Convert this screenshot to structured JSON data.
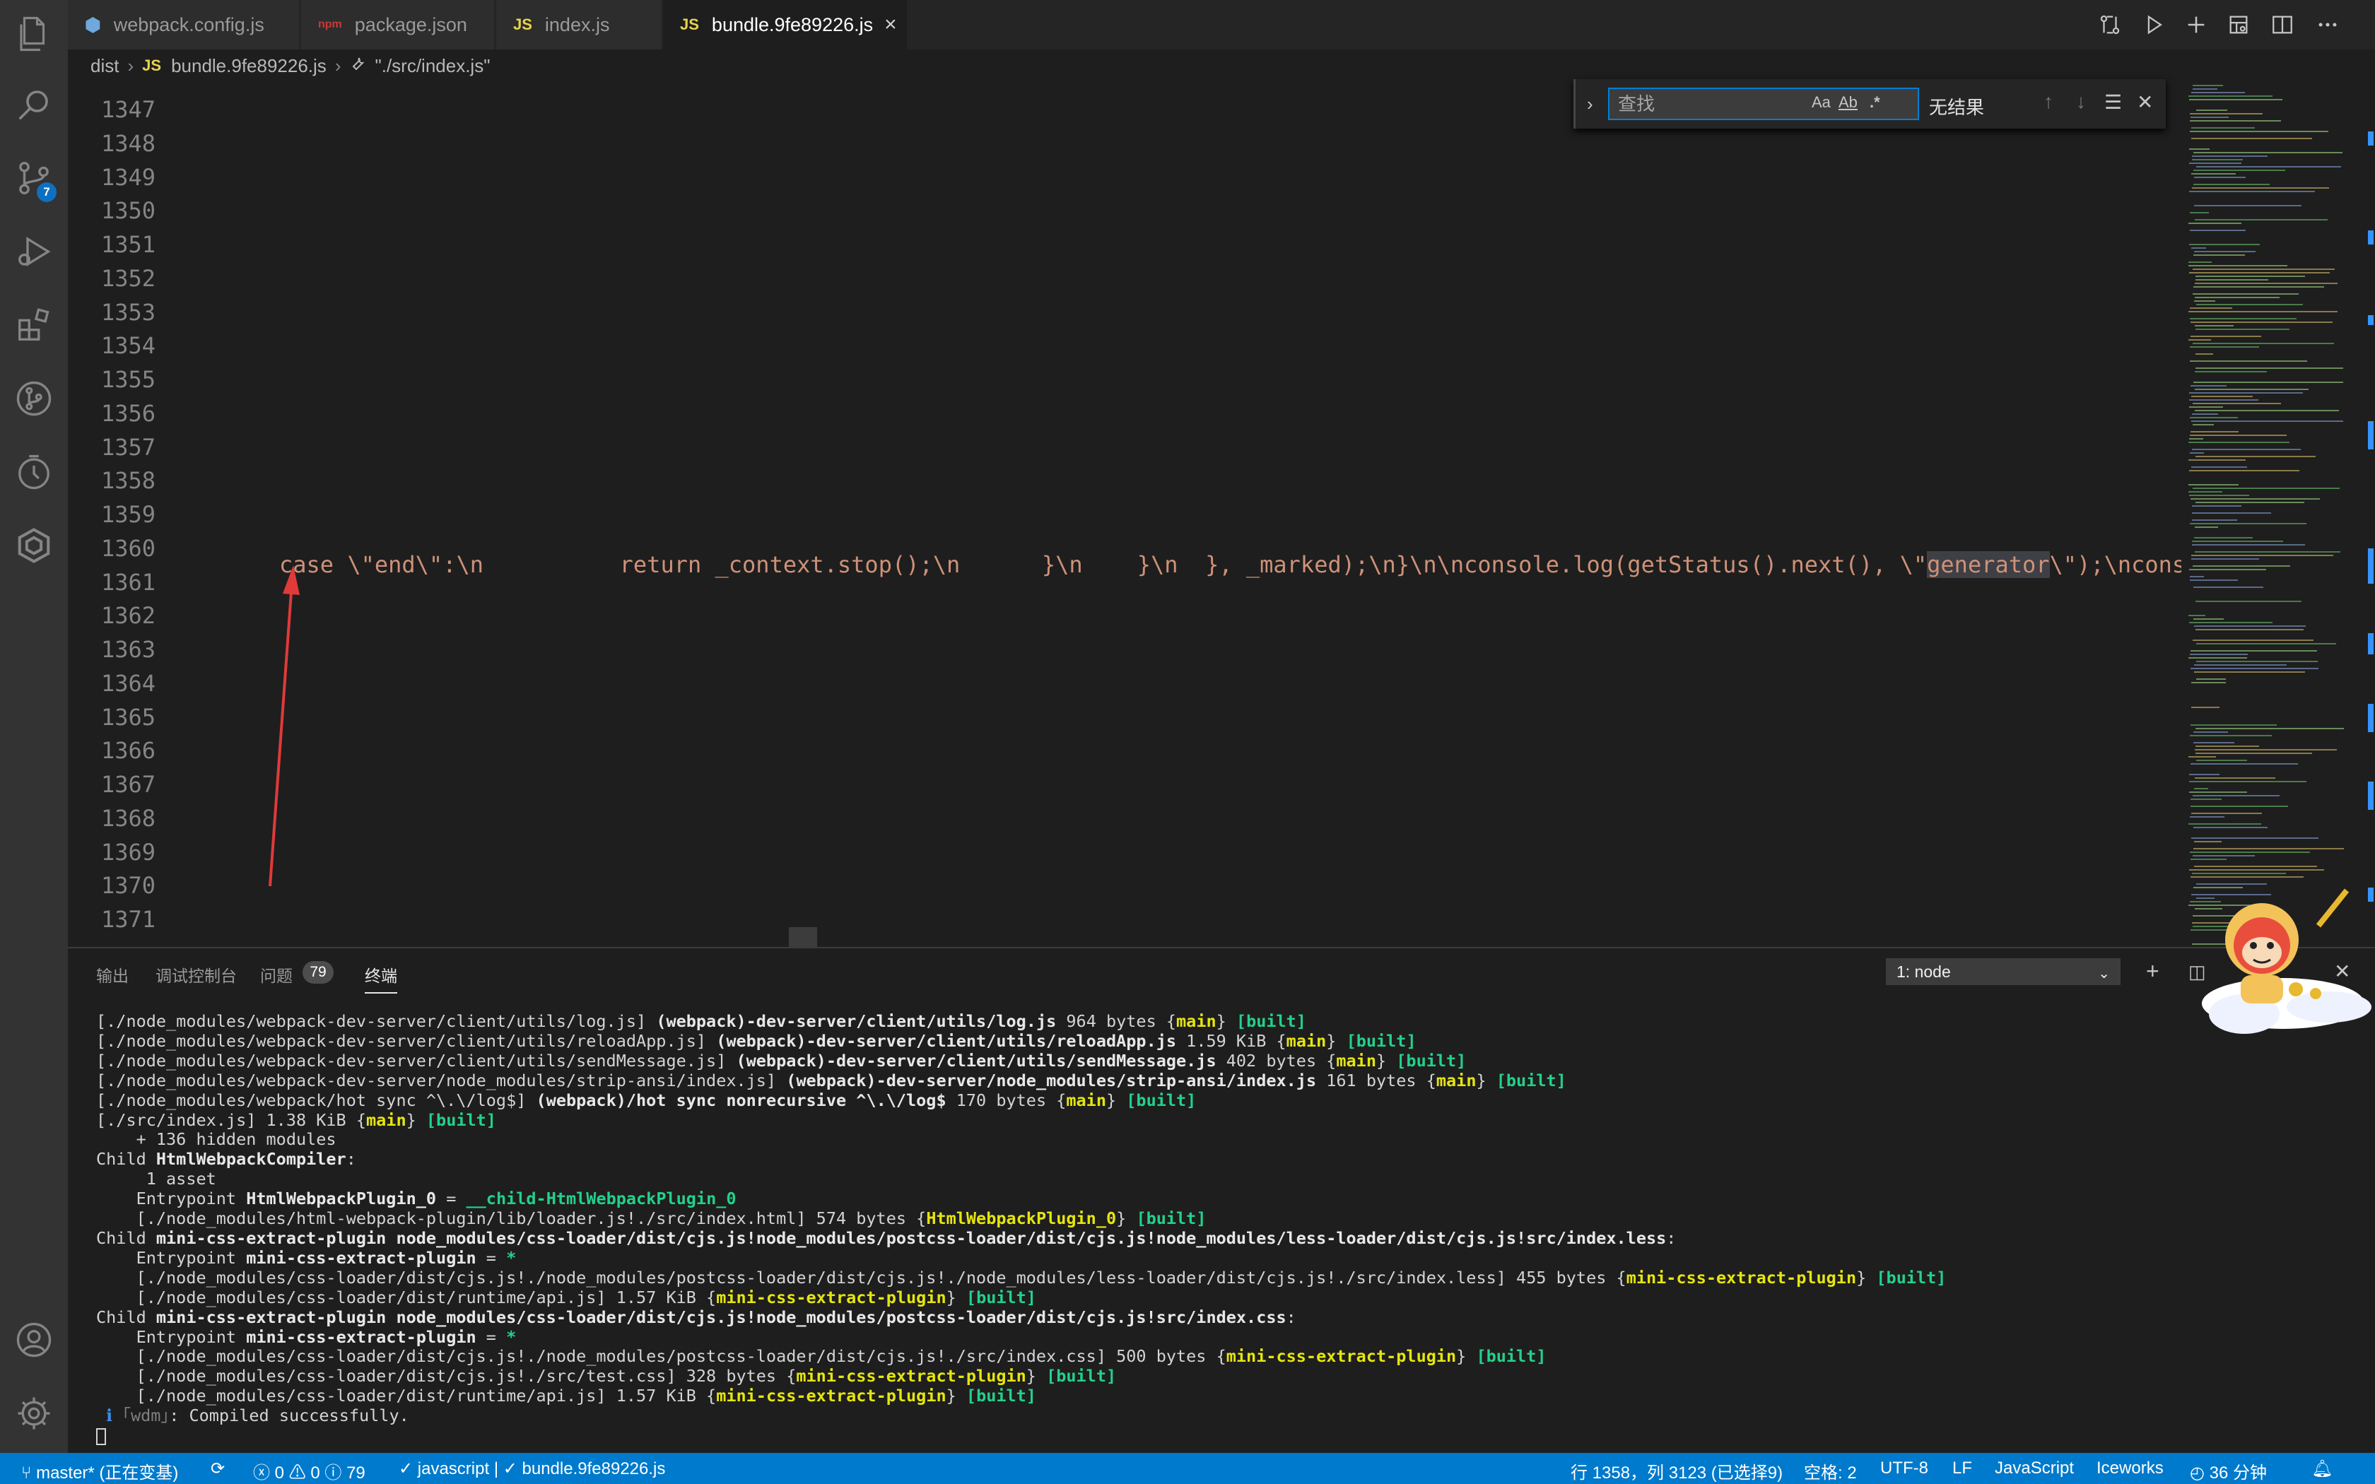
{
  "tabs": [
    {
      "label": "webpack.config.js",
      "icon": "gear-icon"
    },
    {
      "label": "package.json",
      "icon": "npm-icon"
    },
    {
      "label": "index.js",
      "icon": "JS"
    },
    {
      "label": "bundle.9fe89226.js",
      "icon": "JS",
      "active": true
    }
  ],
  "breadcrumb": {
    "folder": "dist",
    "file_icon": "JS",
    "file": "bundle.9fe89226.js",
    "symbol": "\"./src/index.js\""
  },
  "activity": {
    "scm_badge": "7"
  },
  "editor": {
    "line_numbers": [
      "1347",
      "1348",
      "1349",
      "1350",
      "1351",
      "1352",
      "1353",
      "1354",
      "1355",
      "1356",
      "1357",
      "1358",
      "1359",
      "1360",
      "1361",
      "1362",
      "1363",
      "1364",
      "1365",
      "1366",
      "1367",
      "1368",
      "1369",
      "1370",
      "1371"
    ],
    "code_before": "case \\\"end\\\":\\n          return _context.stop();\\n      }\\n    }\\n  }, _marked);\\n}\\n\\nconsole.log(getStatus().next(), \\\"",
    "code_highlight": "generator",
    "code_after": "\\\");\\ncons"
  },
  "find": {
    "placeholder": "查找",
    "opt_case": "Aa",
    "opt_word": "Ab",
    "opt_regex": ".*",
    "result": "无结果"
  },
  "panel": {
    "tabs": [
      "输出",
      "调试控制台",
      "问题",
      "终端"
    ],
    "problems_count": "79",
    "terminal_select": "1: node"
  },
  "terminal_lines": [
    [
      {
        "t": "[./node_modules/webpack-dev-server/client/utils/log.js] "
      },
      {
        "t": "(webpack)-dev-server/client/utils/log.js",
        "c": "b"
      },
      {
        "t": " 964 bytes {"
      },
      {
        "t": "main",
        "c": "y"
      },
      {
        "t": "} "
      },
      {
        "t": "[built]",
        "c": "g"
      }
    ],
    [
      {
        "t": "[./node_modules/webpack-dev-server/client/utils/reloadApp.js] "
      },
      {
        "t": "(webpack)-dev-server/client/utils/reloadApp.js",
        "c": "b"
      },
      {
        "t": " 1.59 KiB {"
      },
      {
        "t": "main",
        "c": "y"
      },
      {
        "t": "} "
      },
      {
        "t": "[built]",
        "c": "g"
      }
    ],
    [
      {
        "t": "[./node_modules/webpack-dev-server/client/utils/sendMessage.js] "
      },
      {
        "t": "(webpack)-dev-server/client/utils/sendMessage.js",
        "c": "b"
      },
      {
        "t": " 402 bytes {"
      },
      {
        "t": "main",
        "c": "y"
      },
      {
        "t": "} "
      },
      {
        "t": "[built]",
        "c": "g"
      }
    ],
    [
      {
        "t": "[./node_modules/webpack-dev-server/node_modules/strip-ansi/index.js] "
      },
      {
        "t": "(webpack)-dev-server/node_modules/strip-ansi/index.js",
        "c": "b"
      },
      {
        "t": " 161 bytes {"
      },
      {
        "t": "main",
        "c": "y"
      },
      {
        "t": "} "
      },
      {
        "t": "[built]",
        "c": "g"
      }
    ],
    [
      {
        "t": "[./node_modules/webpack/hot sync ^\\.\\/log$] "
      },
      {
        "t": "(webpack)/hot sync nonrecursive ^\\.\\/log$",
        "c": "b"
      },
      {
        "t": " 170 bytes {"
      },
      {
        "t": "main",
        "c": "y"
      },
      {
        "t": "} "
      },
      {
        "t": "[built]",
        "c": "g"
      }
    ],
    [
      {
        "t": "[./src/index.js] 1.38 KiB {"
      },
      {
        "t": "main",
        "c": "y"
      },
      {
        "t": "} "
      },
      {
        "t": "[built]",
        "c": "g"
      }
    ],
    [
      {
        "t": "    + 136 hidden modules"
      }
    ],
    [
      {
        "t": "Child "
      },
      {
        "t": "HtmlWebpackCompiler",
        "c": "b"
      },
      {
        "t": ":"
      }
    ],
    [
      {
        "t": "     1 asset"
      }
    ],
    [
      {
        "t": "    Entrypoint "
      },
      {
        "t": "HtmlWebpackPlugin_0",
        "c": "b"
      },
      {
        "t": " = "
      },
      {
        "t": "__child-HtmlWebpackPlugin_0",
        "c": "g"
      }
    ],
    [
      {
        "t": "    [./node_modules/html-webpack-plugin/lib/loader.js!./src/index.html] 574 bytes {"
      },
      {
        "t": "HtmlWebpackPlugin_0",
        "c": "y"
      },
      {
        "t": "} "
      },
      {
        "t": "[built]",
        "c": "g"
      }
    ],
    [
      {
        "t": "Child "
      },
      {
        "t": "mini-css-extract-plugin node_modules/css-loader/dist/cjs.js!node_modules/postcss-loader/dist/cjs.js!node_modules/less-loader/dist/cjs.js!src/index.less",
        "c": "b"
      },
      {
        "t": ":"
      }
    ],
    [
      {
        "t": "    Entrypoint "
      },
      {
        "t": "mini-css-extract-plugin",
        "c": "b"
      },
      {
        "t": " = "
      },
      {
        "t": "*",
        "c": "g"
      }
    ],
    [
      {
        "t": "    [./node_modules/css-loader/dist/cjs.js!./node_modules/postcss-loader/dist/cjs.js!./node_modules/less-loader/dist/cjs.js!./src/index.less] 455 bytes {"
      },
      {
        "t": "mini-css-extract-plugin",
        "c": "y"
      },
      {
        "t": "} "
      },
      {
        "t": "[built]",
        "c": "g"
      }
    ],
    [
      {
        "t": "    [./node_modules/css-loader/dist/runtime/api.js] 1.57 KiB {"
      },
      {
        "t": "mini-css-extract-plugin",
        "c": "y"
      },
      {
        "t": "} "
      },
      {
        "t": "[built]",
        "c": "g"
      }
    ],
    [
      {
        "t": "Child "
      },
      {
        "t": "mini-css-extract-plugin node_modules/css-loader/dist/cjs.js!node_modules/postcss-loader/dist/cjs.js!src/index.css",
        "c": "b"
      },
      {
        "t": ":"
      }
    ],
    [
      {
        "t": "    Entrypoint "
      },
      {
        "t": "mini-css-extract-plugin",
        "c": "b"
      },
      {
        "t": " = "
      },
      {
        "t": "*",
        "c": "g"
      }
    ],
    [
      {
        "t": "    [./node_modules/css-loader/dist/cjs.js!./node_modules/postcss-loader/dist/cjs.js!./src/index.css] 500 bytes {"
      },
      {
        "t": "mini-css-extract-plugin",
        "c": "y"
      },
      {
        "t": "} "
      },
      {
        "t": "[built]",
        "c": "g"
      }
    ],
    [
      {
        "t": "    [./node_modules/css-loader/dist/cjs.js!./src/test.css] 328 bytes {"
      },
      {
        "t": "mini-css-extract-plugin",
        "c": "y"
      },
      {
        "t": "} "
      },
      {
        "t": "[built]",
        "c": "g"
      }
    ],
    [
      {
        "t": "    [./node_modules/css-loader/dist/runtime/api.js] 1.57 KiB {"
      },
      {
        "t": "mini-css-extract-plugin",
        "c": "y"
      },
      {
        "t": "} "
      },
      {
        "t": "[built]",
        "c": "g"
      }
    ],
    [
      {
        "t": " ℹ ",
        "c": "info"
      },
      {
        "t": "｢wdm｣",
        "c": "gray"
      },
      {
        "t": ": Compiled successfully."
      }
    ]
  ],
  "statusbar": {
    "branch": "master* (正在变基)",
    "errors": "0",
    "warnings": "0",
    "info": "79",
    "language_check": "javascript |",
    "file_check": "bundle.9fe89226.js",
    "position": "行 1358，列 3123 (已选择9)",
    "spaces": "空格: 2",
    "encoding": "UTF-8",
    "eol": "LF",
    "language": "JavaScript",
    "iceworks": "Iceworks",
    "timer": "36 分钟"
  },
  "colors": {
    "accent": "#007acc",
    "annotation_arrow": "#e03a3a",
    "string": "#ce9178"
  }
}
